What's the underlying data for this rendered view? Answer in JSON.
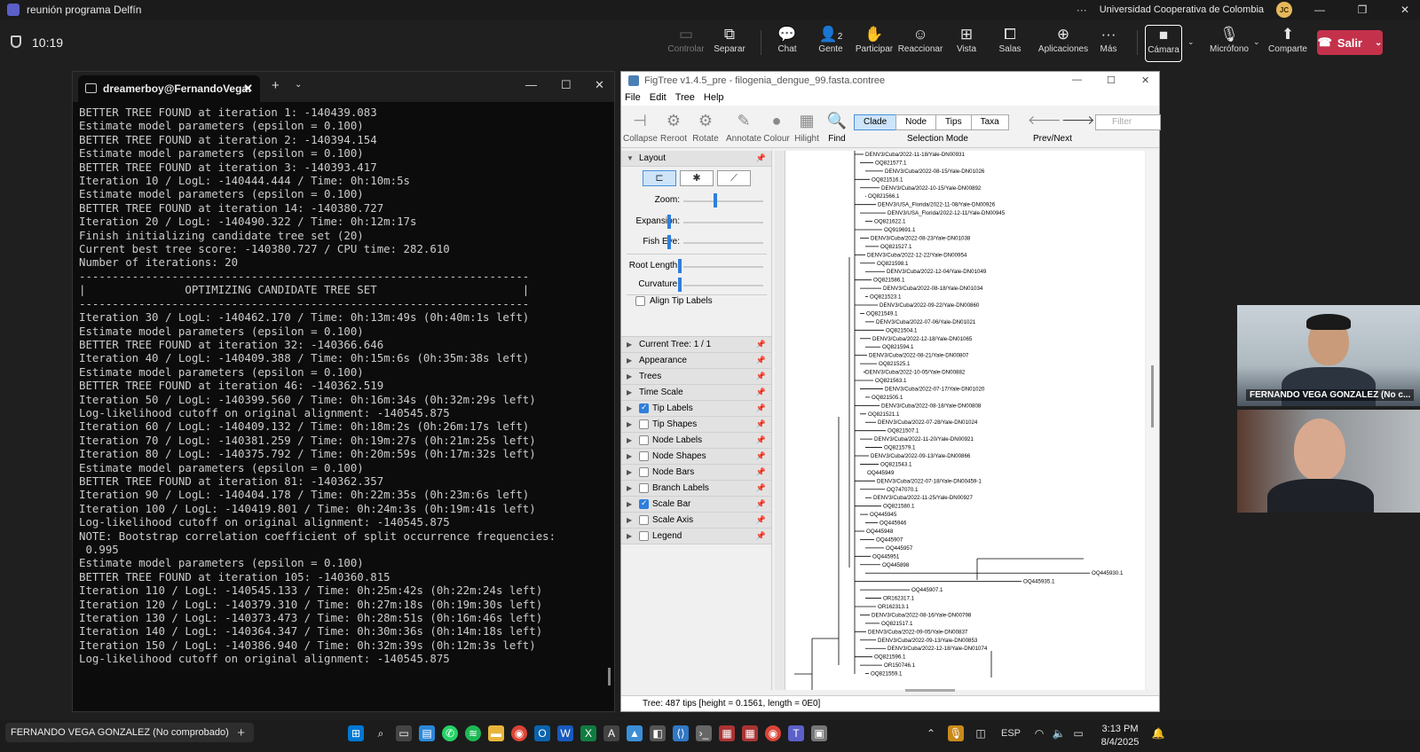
{
  "window": {
    "title": "reunión programa Delfín",
    "org": "Universidad Cooperativa de Colombia",
    "avatar_initials": "JC"
  },
  "meeting": {
    "time": "10:19",
    "buttons": [
      {
        "id": "controlar",
        "label": "Controlar",
        "icon": "control-icon"
      },
      {
        "id": "separar",
        "label": "Separar",
        "icon": "popout-icon"
      },
      {
        "id": "chat",
        "label": "Chat",
        "icon": "chat-icon"
      },
      {
        "id": "gente",
        "label": "Gente",
        "icon": "people-icon",
        "badge": "2"
      },
      {
        "id": "participar",
        "label": "Participar",
        "icon": "raise-hand-icon"
      },
      {
        "id": "reaccionar",
        "label": "Reaccionar",
        "icon": "react-icon"
      },
      {
        "id": "vista",
        "label": "Vista",
        "icon": "view-icon"
      },
      {
        "id": "salas",
        "label": "Salas",
        "icon": "rooms-icon"
      },
      {
        "id": "aplicaciones",
        "label": "Aplicaciones",
        "icon": "apps-icon"
      },
      {
        "id": "mas",
        "label": "Más",
        "icon": "more-icon"
      },
      {
        "id": "camara",
        "label": "Cámara",
        "icon": "camera-icon"
      },
      {
        "id": "microfono",
        "label": "Micrófono",
        "icon": "mic-icon"
      },
      {
        "id": "compartir",
        "label": "Comparte",
        "icon": "share-icon"
      }
    ],
    "leave_label": "Salir"
  },
  "terminal": {
    "tab_title": "dreamerboy@FernandoVega:",
    "lines": [
      "BETTER TREE FOUND at iteration 1: -140439.083",
      "Estimate model parameters (epsilon = 0.100)",
      "BETTER TREE FOUND at iteration 2: -140394.154",
      "Estimate model parameters (epsilon = 0.100)",
      "BETTER TREE FOUND at iteration 3: -140393.417",
      "Iteration 10 / LogL: -140444.444 / Time: 0h:10m:5s",
      "Estimate model parameters (epsilon = 0.100)",
      "BETTER TREE FOUND at iteration 14: -140380.727",
      "Iteration 20 / LogL: -140490.322 / Time: 0h:12m:17s",
      "Finish initializing candidate tree set (20)",
      "Current best tree score: -140380.727 / CPU time: 282.610",
      "Number of iterations: 20",
      "--------------------------------------------------------------------",
      "|               OPTIMIZING CANDIDATE TREE SET                      |",
      "--------------------------------------------------------------------",
      "Iteration 30 / LogL: -140462.170 / Time: 0h:13m:49s (0h:40m:1s left)",
      "Estimate model parameters (epsilon = 0.100)",
      "BETTER TREE FOUND at iteration 32: -140366.646",
      "Iteration 40 / LogL: -140409.388 / Time: 0h:15m:6s (0h:35m:38s left)",
      "Estimate model parameters (epsilon = 0.100)",
      "BETTER TREE FOUND at iteration 46: -140362.519",
      "Iteration 50 / LogL: -140399.560 / Time: 0h:16m:34s (0h:32m:29s left)",
      "Log-likelihood cutoff on original alignment: -140545.875",
      "Iteration 60 / LogL: -140409.132 / Time: 0h:18m:2s (0h:26m:17s left)",
      "Iteration 70 / LogL: -140381.259 / Time: 0h:19m:27s (0h:21m:25s left)",
      "Iteration 80 / LogL: -140375.792 / Time: 0h:20m:59s (0h:17m:32s left)",
      "Estimate model parameters (epsilon = 0.100)",
      "BETTER TREE FOUND at iteration 81: -140362.357",
      "Iteration 90 / LogL: -140404.178 / Time: 0h:22m:35s (0h:23m:6s left)",
      "Iteration 100 / LogL: -140419.801 / Time: 0h:24m:3s (0h:19m:41s left)",
      "Log-likelihood cutoff on original alignment: -140545.875",
      "NOTE: Bootstrap correlation coefficient of split occurrence frequencies:",
      " 0.995",
      "Estimate model parameters (epsilon = 0.100)",
      "BETTER TREE FOUND at iteration 105: -140360.815",
      "Iteration 110 / LogL: -140545.133 / Time: 0h:25m:42s (0h:22m:24s left)",
      "Iteration 120 / LogL: -140379.310 / Time: 0h:27m:18s (0h:19m:30s left)",
      "Iteration 130 / LogL: -140373.473 / Time: 0h:28m:51s (0h:16m:46s left)",
      "Iteration 140 / LogL: -140364.347 / Time: 0h:30m:36s (0h:14m:18s left)",
      "Iteration 150 / LogL: -140386.940 / Time: 0h:32m:39s (0h:12m:3s left)",
      "Log-likelihood cutoff on original alignment: -140545.875"
    ]
  },
  "figtree": {
    "title": "FigTree v1.4.5_pre - filogenia_dengue_99.fasta.contree",
    "menu": [
      "File",
      "Edit",
      "Tree",
      "Help"
    ],
    "tools": [
      "Collapse",
      "Reroot",
      "Rotate",
      "Annotate",
      "Colour",
      "Hilight",
      "Find"
    ],
    "selection_modes": [
      "Clade",
      "Node",
      "Tips",
      "Taxa"
    ],
    "selection_label": "Selection Mode",
    "prevnext_label": "Prev/Next",
    "filter_placeholder": "Filter",
    "layout_label": "Layout",
    "sliders": {
      "zoom": "Zoom:",
      "expansion": "Expansion:",
      "fisheye": "Fish Eye:",
      "root_length": "Root Length:",
      "curvature": "Curvature:"
    },
    "align_tip_labels": "Align Tip Labels",
    "panels": [
      {
        "label": "Current Tree: 1 / 1",
        "checkbox": null
      },
      {
        "label": "Appearance",
        "checkbox": null
      },
      {
        "label": "Trees",
        "checkbox": null
      },
      {
        "label": "Time Scale",
        "checkbox": null
      },
      {
        "label": "Tip Labels",
        "checkbox": true
      },
      {
        "label": "Tip Shapes",
        "checkbox": false
      },
      {
        "label": "Node Labels",
        "checkbox": false
      },
      {
        "label": "Node Shapes",
        "checkbox": false
      },
      {
        "label": "Node Bars",
        "checkbox": false
      },
      {
        "label": "Branch Labels",
        "checkbox": false
      },
      {
        "label": "Scale Bar",
        "checkbox": true
      },
      {
        "label": "Scale Axis",
        "checkbox": false
      },
      {
        "label": "Legend",
        "checkbox": false
      }
    ],
    "tips": [
      "DENV3/Cuba/2022-11-18/Yale-DN00931",
      "OQ821577.1",
      "DENV3/Cuba/2022-08-15/Yale-DN01026",
      "OQ821516.1",
      "DENV3/Cuba/2022-10-15/Yale-DN00892",
      "OQ821566.1",
      "DENV3/USA_Florida/2022-11-08/Yale-DN00926",
      "DENV3/USA_Florida/2022-12-11/Yale-DN00945",
      "OQ821622.1",
      "OQ919691.1",
      "DENV3/Cuba/2022-08-23/Yale-DN01038",
      "OQ821527.1",
      "DENV3/Cuba/2022-12-22/Yale-DN00954",
      "OQ821598.1",
      "DENV3/Cuba/2022-12-04/Yale-DN01049",
      "OQ821586.1",
      "DENV3/Cuba/2022-08-18/Yale-DN01034",
      "OQ821523.1",
      "DENV3/Cuba/2022-09-22/Yale-DN00860",
      "OQ821549.1",
      "DENV3/Cuba/2022-07-06/Yale-DN01021",
      "OQ821504.1",
      "DENV3/Cuba/2022-12-18/Yale-DN01065",
      "OQ821594.1",
      "DENV3/Cuba/2022-08-21/Yale-DN00807",
      "OQ821525.1",
      "DENV3/Cuba/2022-10-05/Yale-DN00882",
      "OQ821563.1",
      "DENV3/Cuba/2022-07-17/Yale-DN01020",
      "OQ821505.1",
      "DENV3/Cuba/2022-08-18/Yale-DN00808",
      "OQ821521.1",
      "DENV3/Cuba/2022-07-28/Yale-DN01024",
      "OQ821507.1",
      "DENV3/Cuba/2022-11-20/Yale-DN00921",
      "OQ821579.1",
      "DENV3/Cuba/2022-09-13/Yale-DN00866",
      "OQ821543.1",
      "OQ445949",
      "DENV3/Cuba/2022-07-18/Yale-DN00459-1",
      "OQ747070.1",
      "DENV3/Cuba/2022-11-25/Yale-DN00927",
      "OQ821580.1",
      "OQ445945",
      "OQ445946",
      "OQ445948",
      "OQ445907",
      "OQ445957",
      "OQ445951",
      "OQ445898",
      "OQ445930.1",
      "OQ445935.1",
      "OQ445907.1",
      "OR162317.1",
      "OR162313.1",
      "DENV3/Cuba/2022-08-16/Yale-DN00798",
      "OQ821517.1",
      "DENV3/Cuba/2022-09-05/Yale-DN00837",
      "DENV3/Cuba/2022-09-13/Yale-DN00853",
      "DENV3/Cuba/2022-12-18/Yale-DN01074",
      "OQ821596.1",
      "OR150746.1",
      "OQ821559.1"
    ],
    "status": "Tree: 487 tips [height = 0.1561, length = 0E0]"
  },
  "videos": [
    {
      "name": "FERNANDO VEGA GONZALEZ (No c..."
    },
    {
      "name": ""
    }
  ],
  "taskbar": {
    "presenter": "FERNANDO VEGA GONZALEZ (No comprobado)",
    "lang": "ESP",
    "time": "3:13 PM",
    "date": "8/4/2025"
  }
}
